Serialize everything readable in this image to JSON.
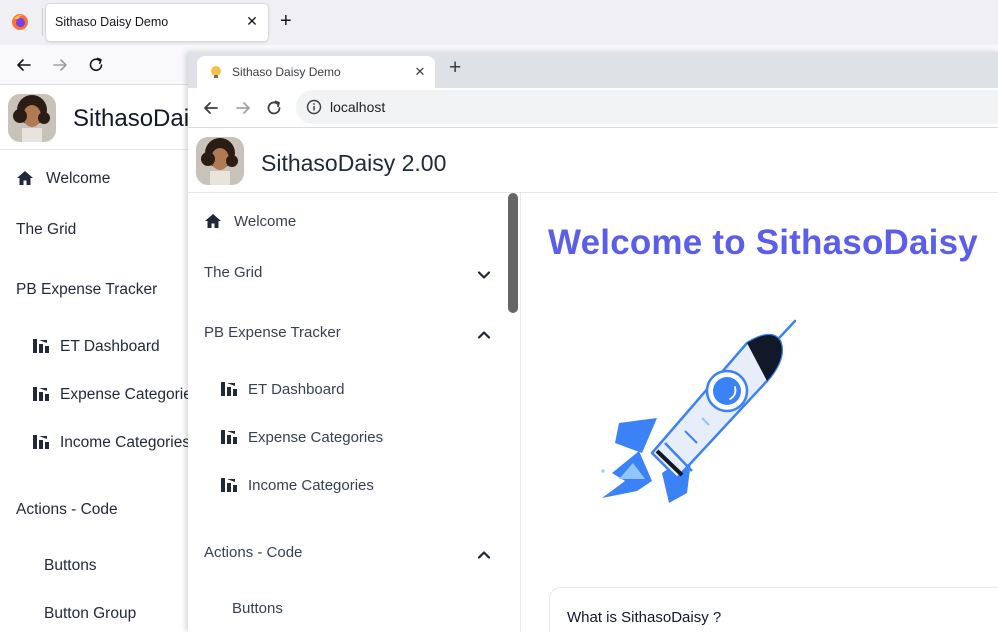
{
  "back_window": {
    "tab_title": "Sithaso Daisy Demo",
    "app_title": "SithasoDai",
    "sidebar": [
      {
        "label": "Welcome",
        "icon": "home-icon"
      },
      {
        "label": "The Grid"
      },
      {
        "label": "PB Expense Tracker"
      },
      {
        "label": "ET Dashboard",
        "icon": "chart-icon"
      },
      {
        "label": "Expense Categorie",
        "icon": "chart-icon"
      },
      {
        "label": "Income Categories",
        "icon": "chart-icon"
      },
      {
        "label": "Actions - Code"
      },
      {
        "label": "Buttons"
      },
      {
        "label": "Button Group"
      }
    ]
  },
  "front_window": {
    "tab_title": "Sithaso Daisy Demo",
    "url": "localhost",
    "app_title": "SithasoDaisy 2.00",
    "sidebar": [
      {
        "label": "Welcome",
        "icon": "home-icon"
      },
      {
        "label": "The Grid",
        "chevron": "down"
      },
      {
        "label": "PB Expense Tracker",
        "chevron": "up"
      },
      {
        "label": "ET Dashboard",
        "icon": "chart-icon"
      },
      {
        "label": "Expense Categories",
        "icon": "chart-icon"
      },
      {
        "label": "Income Categories",
        "icon": "chart-icon"
      },
      {
        "label": "Actions - Code",
        "chevron": "up"
      },
      {
        "label": "Buttons"
      }
    ],
    "main": {
      "heading": "Welcome to SithasoDaisy",
      "card_title": "What is SithasoDaisy ?"
    }
  },
  "colors": {
    "accent": "#5b5ee8",
    "rocket_blue": "#3b82f6",
    "rocket_light": "#e8eef9"
  }
}
